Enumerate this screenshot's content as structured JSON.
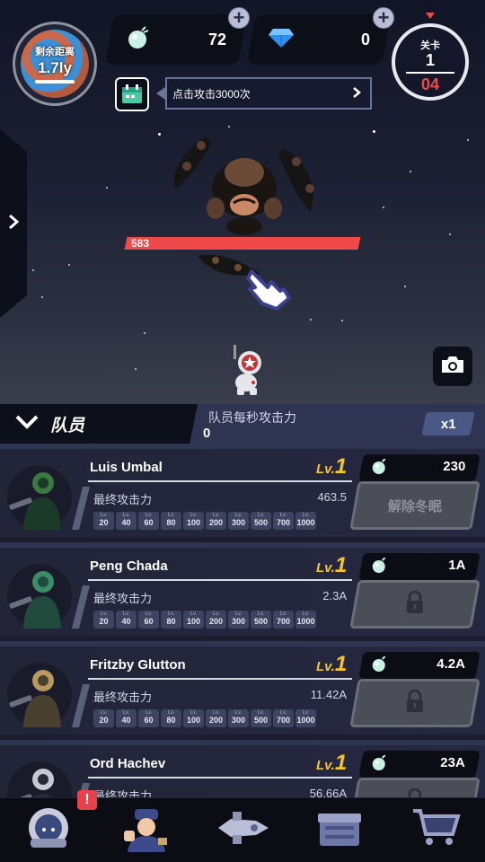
{
  "hud": {
    "distance_label": "剩余距离",
    "distance_value": "1.7ly",
    "energy_amount": "72",
    "gem_amount": "0",
    "stage_label": "关卡",
    "stage_number": "1",
    "stage_wave": "04"
  },
  "quest": {
    "text": "点击攻击3000次"
  },
  "boss": {
    "hp": "583"
  },
  "crew_panel": {
    "title": "队员",
    "dps_label": "队员每秒攻击力",
    "dps_value": "0",
    "multiplier": "x1"
  },
  "crew": [
    {
      "name": "Luis Umbal",
      "lv_label": "Lv.",
      "level": "1",
      "attack_label": "最终攻击力",
      "attack_value": "463.5",
      "cost": "230",
      "button_label": "解除冬眠",
      "locked": false
    },
    {
      "name": "Peng Chada",
      "lv_label": "Lv.",
      "level": "1",
      "attack_label": "最终攻击力",
      "attack_value": "2.3A",
      "cost": "1A",
      "locked": true
    },
    {
      "name": "Fritzby Glutton",
      "lv_label": "Lv.",
      "level": "1",
      "attack_label": "最终攻击力",
      "attack_value": "11.42A",
      "cost": "4.2A",
      "locked": true
    },
    {
      "name": "Ord Hachev",
      "lv_label": "Lv.",
      "level": "1",
      "attack_label": "最终攻击力",
      "attack_value": "56.66A",
      "cost": "23A",
      "locked": true
    }
  ],
  "milestone_prefix": "Lv.",
  "milestones": [
    "20",
    "40",
    "60",
    "80",
    "100",
    "200",
    "300",
    "500",
    "700",
    "1000"
  ],
  "nav": {
    "badge": "!",
    "items": [
      "captain-icon",
      "crew-icon",
      "ship-icon",
      "chest-icon",
      "shop-icon"
    ]
  },
  "colors": {
    "accent_gold": "#f5c52a",
    "hp_red": "#ef4a4a",
    "wave_red": "#e94b4b",
    "badge_red": "#e8414c"
  }
}
